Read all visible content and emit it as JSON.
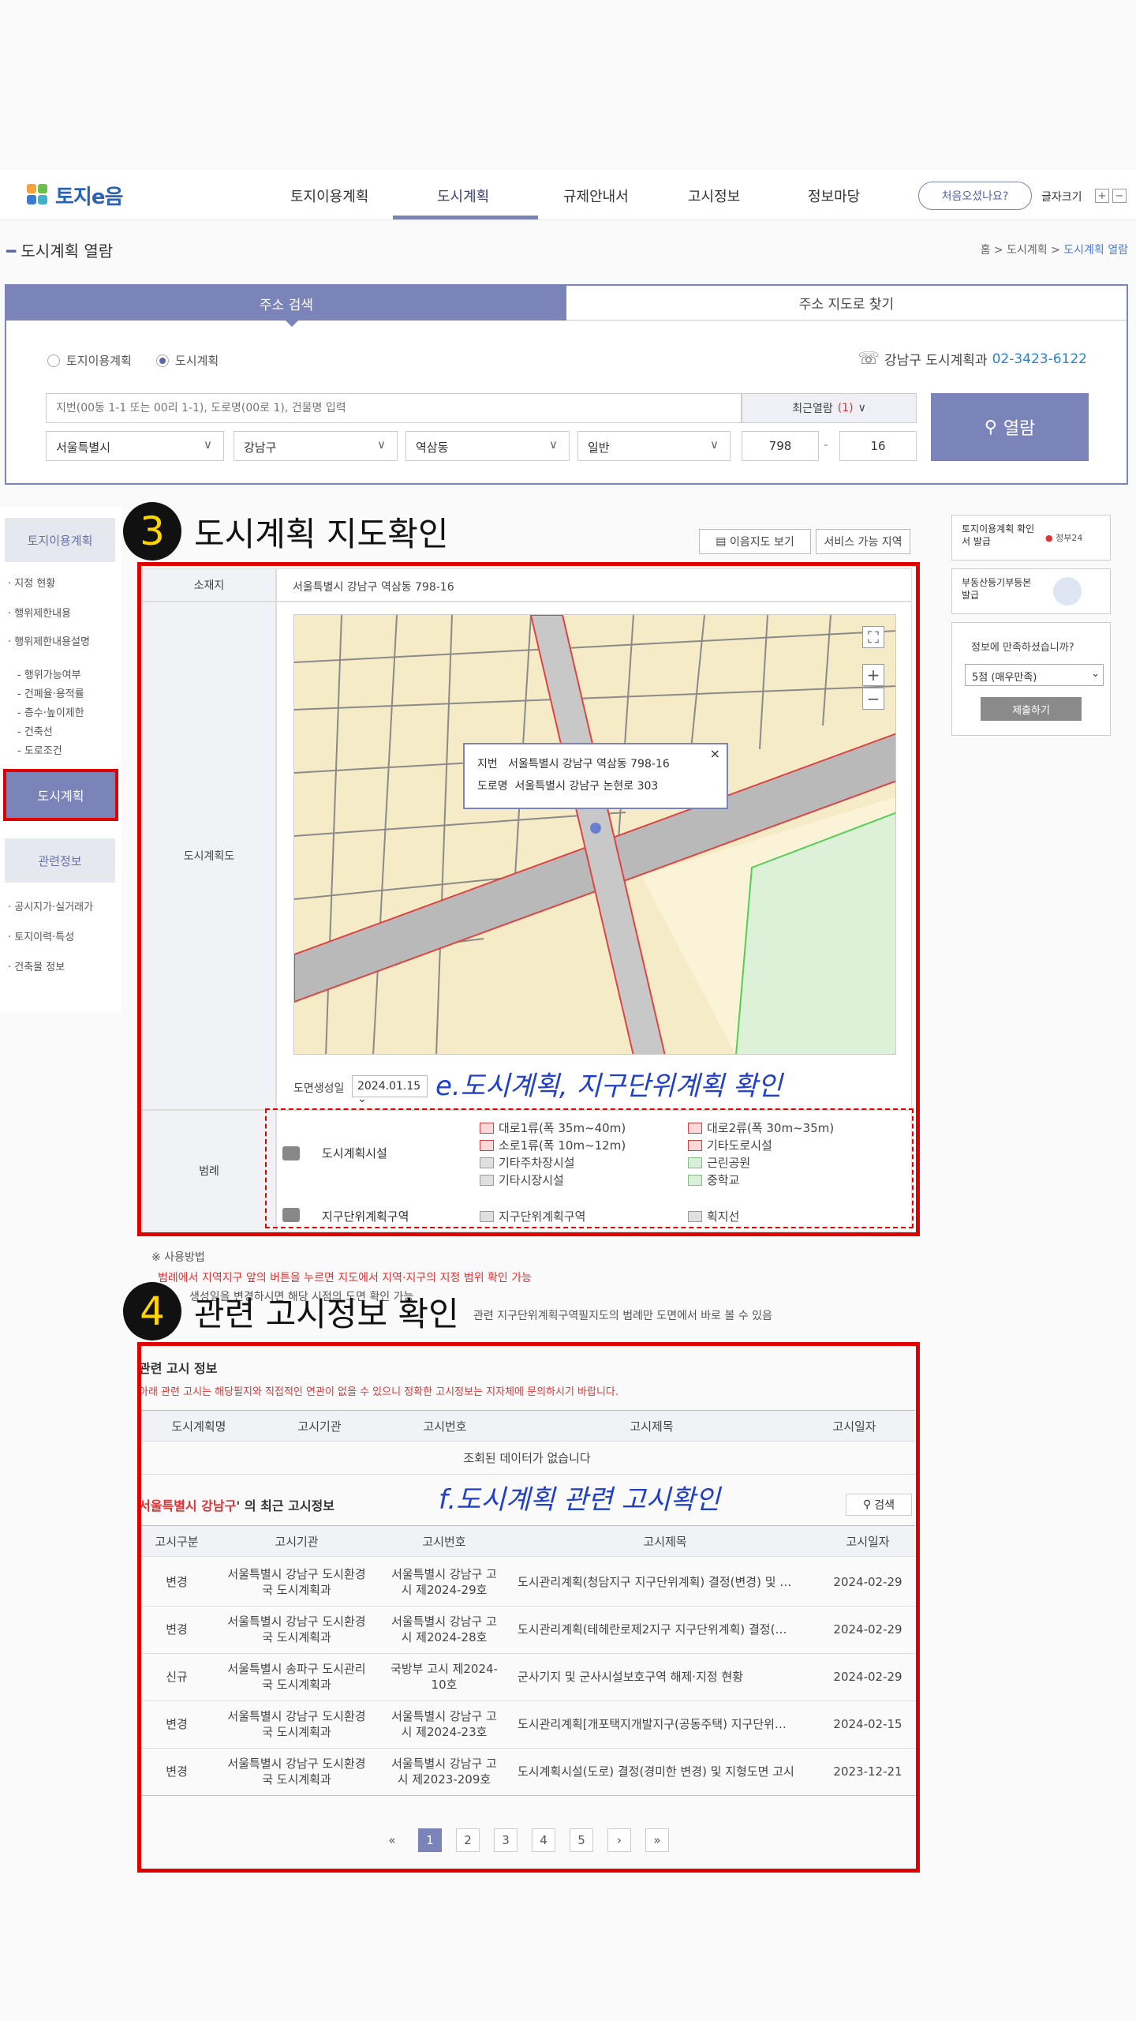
{
  "nav": {
    "logo": "토지e음",
    "menu": [
      "토지이용계획",
      "도시계획",
      "규제안내서",
      "고시정보",
      "정보마당"
    ],
    "first_visit": "처음오셨나요?",
    "font_size_label": "글자크기",
    "plus": "+",
    "minus": "−"
  },
  "page": {
    "title": "도시계획 열람",
    "breadcrumb": [
      "홈",
      "도시계획",
      "도시계획 열람"
    ]
  },
  "search": {
    "tab_active": "주소 검색",
    "tab_inactive": "주소 지도로 찾기",
    "radio_1": "토지이용계획",
    "radio_2": "도시계획",
    "phone_label": "강남구 도시계획과",
    "phone_number": "02-3423-6122",
    "placeholder": "지번(00동 1-1 또는 00리 1-1), 도로명(00로 1), 건물명 입력",
    "recent_label": "최근열람",
    "recent_count": "(1)",
    "sido": "서울특별시",
    "sigungu": "강남구",
    "dong": "역삼동",
    "type": "일반",
    "bonbun": "798",
    "dash": "-",
    "bubun": "16",
    "open_btn": "열람"
  },
  "left_sidebar": {
    "head1": "토지이용계획",
    "items1": [
      "지정 현황",
      "행위제한내용",
      "행위제한내용설명"
    ],
    "subs": [
      "행위가능여부",
      "건폐율·용적률",
      "층수·높이제한",
      "건축선",
      "도로조건"
    ],
    "active": "도시계획",
    "head2": "관련정보",
    "items2": [
      "공시지가·실거래가",
      "토지이력·특성",
      "건축물 정보"
    ]
  },
  "right_sidebar": {
    "box1": "토지이용계획 확인서 발급",
    "gov24": "정부24",
    "box2": "부동산등기부등본 발급",
    "survey_q": "정보에 만족하셨습니까?",
    "survey_sel": "5점 (매우만족)",
    "submit": "제출하기"
  },
  "section3": {
    "num": "3",
    "title": "도시계획 지도확인",
    "btn_map": "이음지도 보기",
    "btn_area": "서비스 가능 지역",
    "loc_label": "소재지",
    "loc_value": "서울특별시 강남구 역삼동 798-16",
    "map_label": "도시계획도",
    "popup_jibun_label": "지번",
    "popup_jibun": "서울특별시 강남구 역삼동 798-16",
    "popup_road_label": "도로명",
    "popup_road": "서울특별시 강남구 논현로 303",
    "map_date_label": "도면생성일",
    "map_date": "2024.01.15",
    "note": "e.도시계획, 지구단위계획 확인",
    "legend_label": "범례",
    "legend_row1": "도시계획시설",
    "legend_row2": "지구단위계획구역",
    "legend_items": [
      "대로1류(폭 35m~40m)",
      "대로2류(폭 30m~35m)",
      "소로1류(폭 10m~12m)",
      "기타도로시설",
      "기타주차장시설",
      "근린공원",
      "기타시장시설",
      "중학교"
    ],
    "legend_items2": [
      "지구단위계획구역",
      "획지선"
    ]
  },
  "usage": {
    "title": "※ 사용방법",
    "line1": "범례에서 지역지구 앞의 버튼을 누르면 지도에서 지역·지구의 지정 범위 확인 가능",
    "line2": "생성일을 변경하시면 해당 시점의 도면 확인 가능",
    "line3": "관련 지구단위계획구역필지도의 범례만 도면에서 바로 볼 수 있음"
  },
  "section4": {
    "num": "4",
    "title": "관련 고시정보 확인",
    "sub_title": "관련 고시 정보",
    "warning": "아래 관련 고시는 해당필지와 직접적인 연관이 없을 수 있으니 정확한 고시정보는 지자체에 문의하시기 바랍니다.",
    "head1": [
      "도시계획명",
      "고시기관",
      "고시번호",
      "고시제목",
      "고시일자"
    ],
    "empty": "조회된 데이터가 없습니다",
    "recent_title_red": "서울특별시 강남구",
    "recent_title_rest": "' 의 최근 고시정보",
    "search_btn": "검색",
    "note": "f.도시계획 관련 고시확인",
    "head2": [
      "고시구분",
      "고시기관",
      "고시번호",
      "고시제목",
      "고시일자"
    ],
    "rows": [
      [
        "변경",
        "서울특별시 강남구 도시환경국 도시계획과",
        "서울특별시 강남구 고시 제2024-29호",
        "도시관리계획(청담지구 지구단위계획) 결정(변경) 및 …",
        "2024-02-29"
      ],
      [
        "변경",
        "서울특별시 강남구 도시환경국 도시계획과",
        "서울특별시 강남구 고시 제2024-28호",
        "도시관리계획(테헤란로제2지구 지구단위계획) 결정(…",
        "2024-02-29"
      ],
      [
        "신규",
        "서울특별시 송파구 도시관리국 도시계획과",
        "국방부 고시 제2024-10호",
        "군사기지 및 군사시설보호구역 해제·지정 현황",
        "2024-02-29"
      ],
      [
        "변경",
        "서울특별시 강남구 도시환경국 도시계획과",
        "서울특별시 강남구 고시 제2024-23호",
        "도시관리계획[개포택지개발지구(공동주택) 지구단위…",
        "2024-02-15"
      ],
      [
        "변경",
        "서울특별시 강남구 도시환경국 도시계획과",
        "서울특별시 강남구 고시 제2023-209호",
        "도시계획시설(도로) 결정(경미한 변경) 및 지형도면 고시",
        "2023-12-21"
      ]
    ],
    "pager": [
      "«",
      "1",
      "2",
      "3",
      "4",
      "5",
      "›",
      "»"
    ]
  }
}
